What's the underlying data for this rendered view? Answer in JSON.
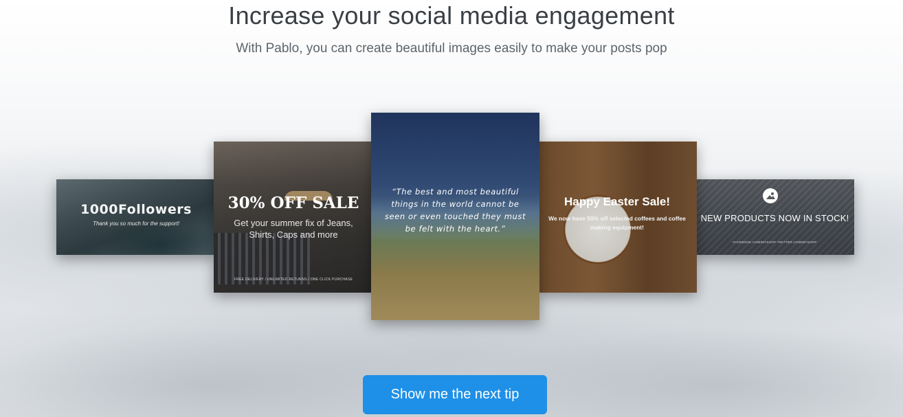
{
  "header": {
    "title": "Increase your social media engagement",
    "subtitle": "With Pablo, you can create beautiful images easily to make your posts pop"
  },
  "examples": {
    "card_1": {
      "title": "1000Followers",
      "tagline": "Thank you so much for the support!"
    },
    "card_2": {
      "title": "30% OFF SALE",
      "body": "Get your summer fix of Jeans, Shirts, Caps and more",
      "fine_print": "FREE DELIVERY / UNLIMITED RETURNS / ONE CLICK PURCHASE"
    },
    "card_3": {
      "quote": "“The best and most beautiful things in the world cannot be seen or even touched they must be felt with the heart.”"
    },
    "card_4": {
      "title": "Happy Easter Sale!",
      "body": "We now have 50% off selected coffees and coffee making equipment!"
    },
    "card_5": {
      "icon": "image-icon",
      "title": "NEW PRODUCTS NOW IN STOCK!",
      "fine_print": "FACEBOOK.COM/MYSHOP   TWITTER.COM/MYSHOP"
    }
  },
  "cta": {
    "label": "Show me the next tip",
    "color": "#1e90e8"
  }
}
